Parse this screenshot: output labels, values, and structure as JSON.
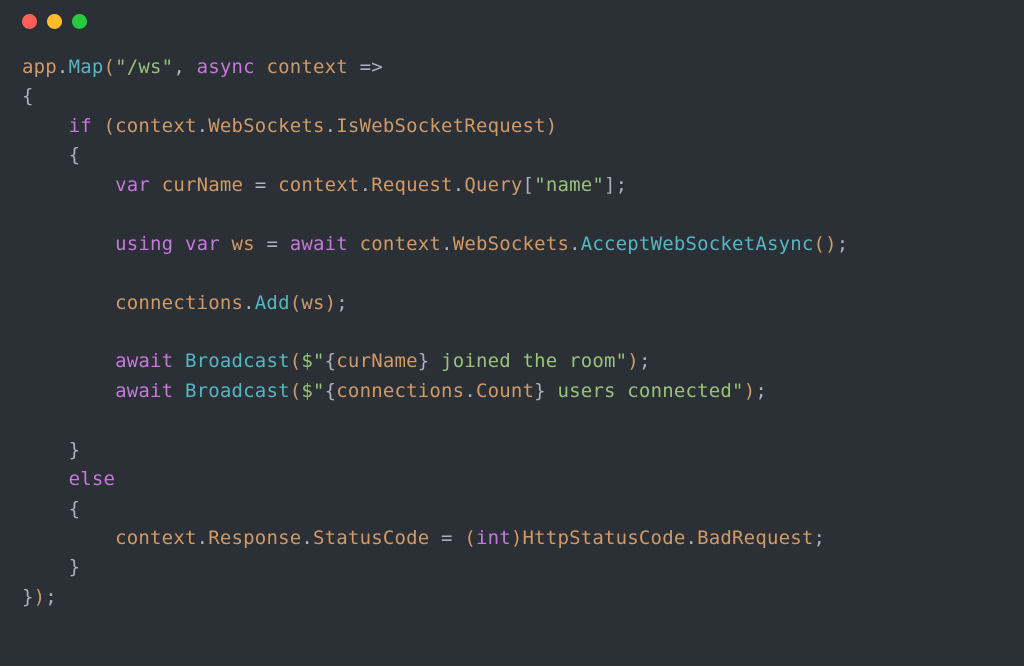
{
  "colors": {
    "trafficRed": "#ff5f56",
    "trafficYellow": "#ffbd2e",
    "trafficGreen": "#27c93f",
    "background": "#2b2f36"
  },
  "code": {
    "l1": {
      "app": "app",
      "dot1": ".",
      "map": "Map",
      "p1": "(",
      "str": "\"/ws\"",
      "comma": ", ",
      "async": "async",
      "sp": " ",
      "ctx": "context",
      "arrow": " =>"
    },
    "l2": {
      "brace": "{"
    },
    "l3": {
      "indent": "    ",
      "if": "if",
      "sp": " ",
      "p1": "(",
      "ctx": "context",
      "dot1": ".",
      "ws": "WebSockets",
      "dot2": ".",
      "isreq": "IsWebSocketRequest",
      "p2": ")"
    },
    "l4": {
      "indent": "    ",
      "brace": "{"
    },
    "l5": {
      "indent": "        ",
      "var": "var",
      "sp": " ",
      "name": "curName",
      "eq": " = ",
      "ctx": "context",
      "dot1": ".",
      "req": "Request",
      "dot2": ".",
      "query": "Query",
      "b1": "[",
      "str": "\"name\"",
      "b2": "]",
      "semi": ";"
    },
    "l6": {
      "indent": "        ",
      "using": "using",
      "sp1": " ",
      "var": "var",
      "sp2": " ",
      "ws": "ws",
      "eq": " = ",
      "await": "await",
      "sp3": " ",
      "ctx": "context",
      "dot1": ".",
      "wss": "WebSockets",
      "dot2": ".",
      "accept": "AcceptWebSocketAsync",
      "p1": "(",
      "p2": ")",
      "semi": ";"
    },
    "l7": {
      "indent": "        ",
      "conn": "connections",
      "dot": ".",
      "add": "Add",
      "p1": "(",
      "ws": "ws",
      "p2": ")",
      "semi": ";"
    },
    "l8": {
      "indent": "        ",
      "await": "await",
      "sp": " ",
      "bc": "Broadcast",
      "p1": "(",
      "dollar": "$",
      "q1": "\"",
      "b1": "{",
      "cur": "curName",
      "b2": "}",
      "txt": " joined the room",
      "q2": "\"",
      "p2": ")",
      "semi": ";"
    },
    "l9": {
      "indent": "        ",
      "await": "await",
      "sp": " ",
      "bc": "Broadcast",
      "p1": "(",
      "dollar": "$",
      "q1": "\"",
      "b1": "{",
      "conn": "connections",
      "dot": ".",
      "count": "Count",
      "b2": "}",
      "txt": " users connected",
      "q2": "\"",
      "p2": ")",
      "semi": ";"
    },
    "l10": {
      "indent": "    ",
      "brace": "}"
    },
    "l11": {
      "indent": "    ",
      "else": "else"
    },
    "l12": {
      "indent": "    ",
      "brace": "{"
    },
    "l13": {
      "indent": "        ",
      "ctx": "context",
      "dot1": ".",
      "resp": "Response",
      "dot2": ".",
      "sc": "StatusCode",
      "eq": " = ",
      "p1": "(",
      "int": "int",
      "p2": ")",
      "hsc": "HttpStatusCode",
      "dot3": ".",
      "br": "BadRequest",
      "semi": ";"
    },
    "l14": {
      "indent": "    ",
      "brace": "}"
    },
    "l15": {
      "brace": "}",
      "p": ")",
      "semi": ";"
    }
  }
}
